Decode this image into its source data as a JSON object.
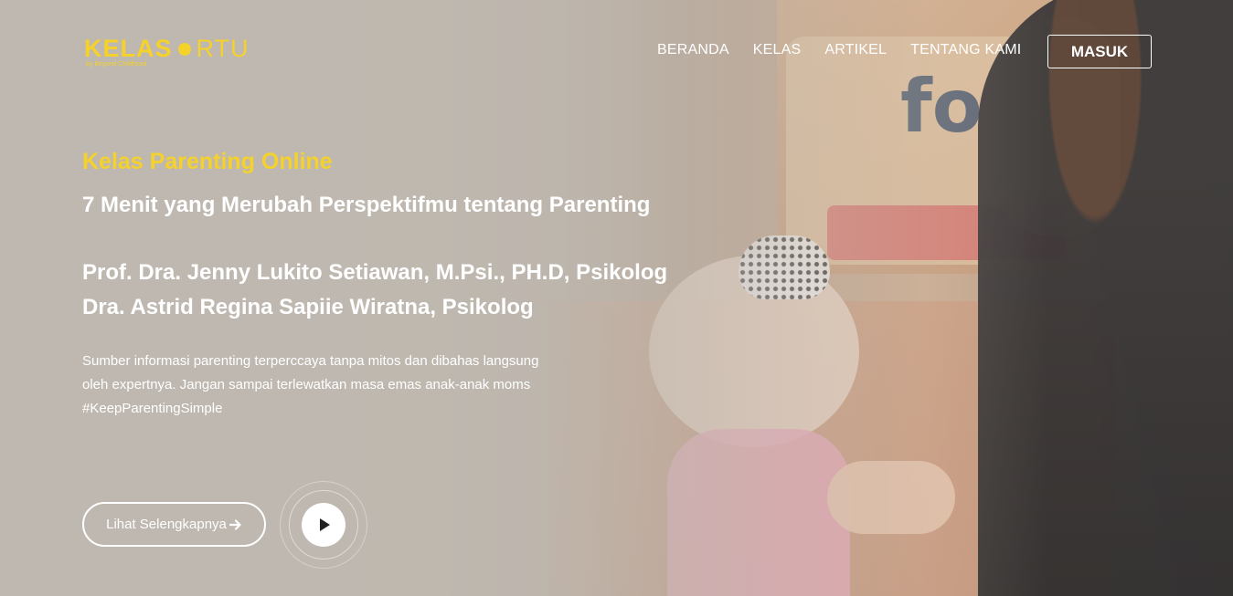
{
  "header": {
    "logo": {
      "word1": "KELAS",
      "word2": "RTU",
      "tagline": "by Beyond Childhood"
    },
    "nav": [
      {
        "label": "BERANDA"
      },
      {
        "label": "KELAS"
      },
      {
        "label": "ARTIKEL"
      },
      {
        "label": "TENTANG KAMI"
      }
    ],
    "login_label": "MASUK"
  },
  "hero": {
    "kicker": "Kelas Parenting Online",
    "headline": "7 Menit yang Merubah Perspektifmu tentang Parenting",
    "speakers": [
      "Prof. Dra. Jenny Lukito Setiawan, M.Psi., PH.D, Psikolog",
      "Dra. Astrid Regina Sapiie Wiratna, Psikolog"
    ],
    "description": [
      "Sumber informasi parenting terperccaya tanpa mitos dan dibahas langsung",
      "oleh expertnya. Jangan sampai terlewatkan masa emas anak-anak moms",
      "#KeepParentingSimple"
    ],
    "cta_label": "Lihat Selengkapnya",
    "background_text": "fo"
  },
  "colors": {
    "accent": "#f5d12b",
    "text": "#ffffff"
  },
  "icons": {
    "cta": "arrow-right-icon",
    "video": "play-icon"
  }
}
